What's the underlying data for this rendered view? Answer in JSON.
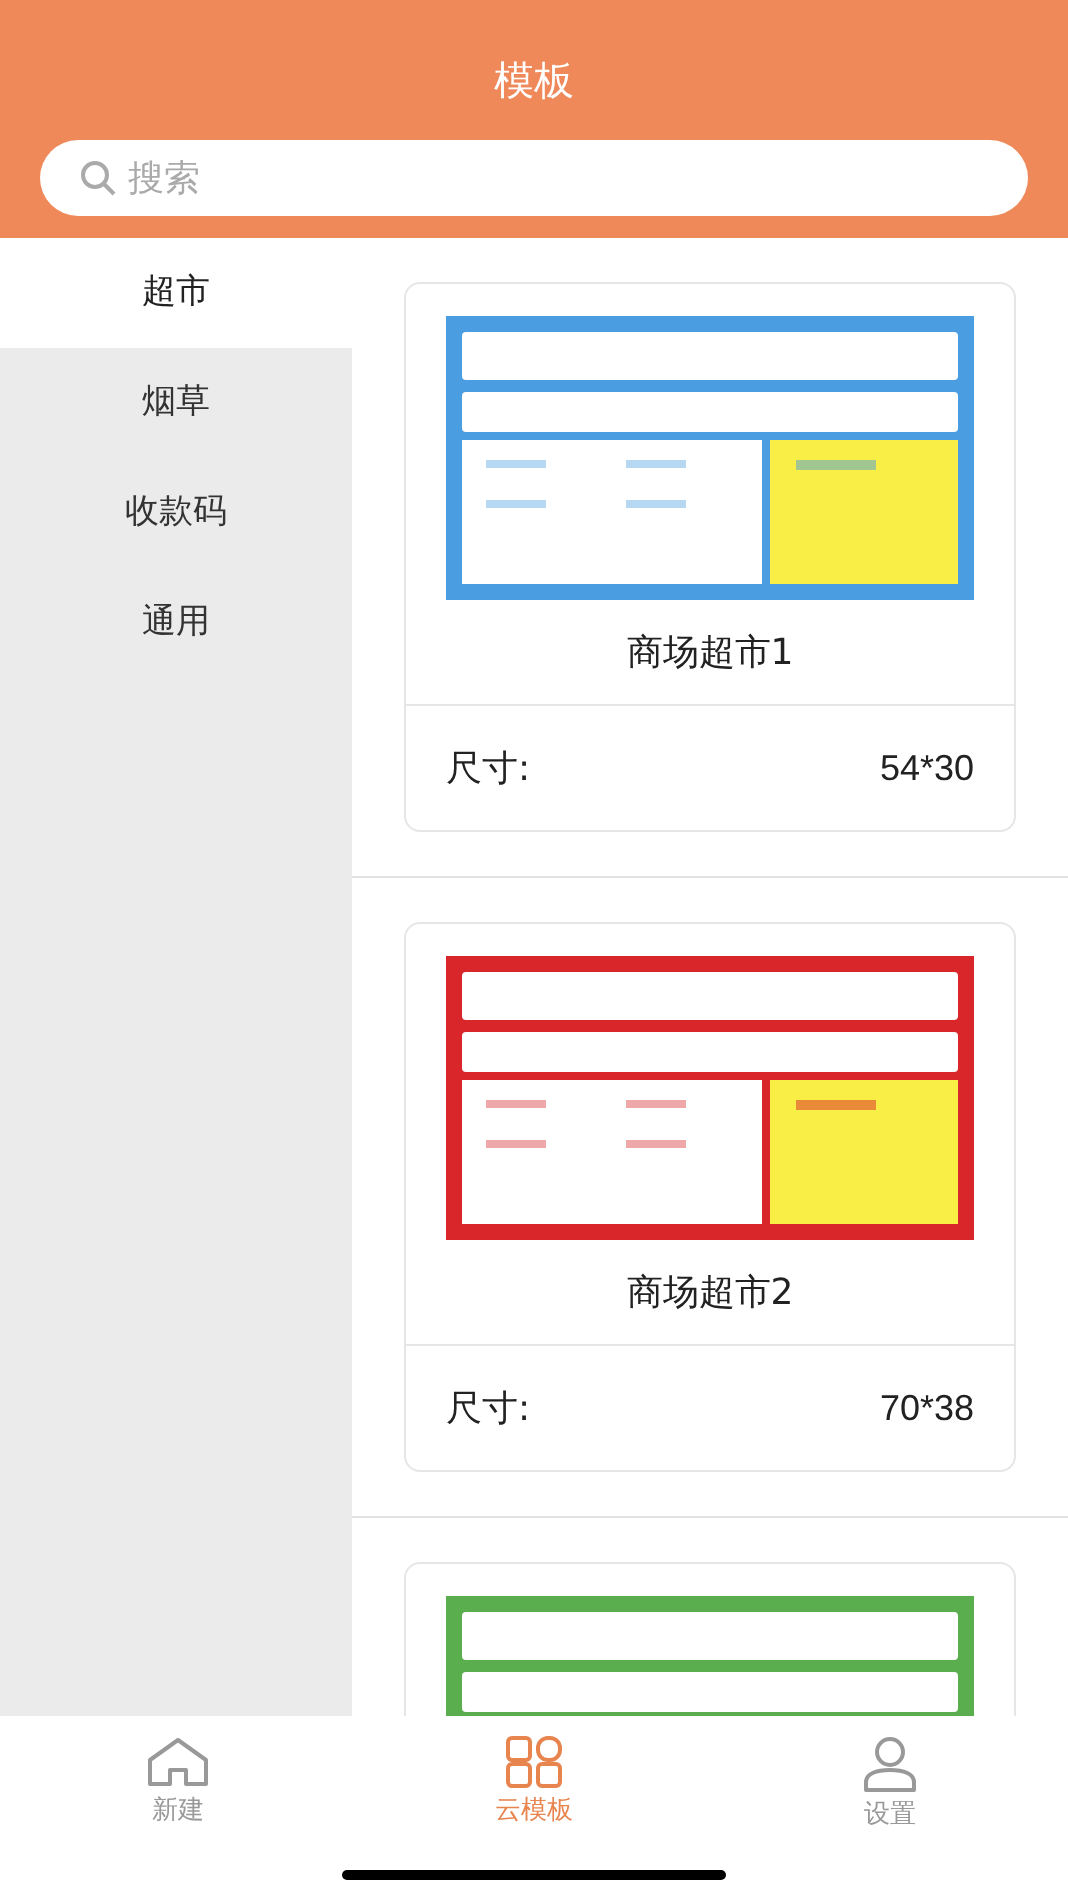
{
  "header": {
    "title": "模板"
  },
  "search": {
    "placeholder": "搜索"
  },
  "sidebar": {
    "items": [
      {
        "label": "超市",
        "selected": true
      },
      {
        "label": "烟草",
        "selected": false
      },
      {
        "label": "收款码",
        "selected": false
      },
      {
        "label": "通用",
        "selected": false
      }
    ]
  },
  "templates": [
    {
      "kind": "picture",
      "color": "#4a9de0",
      "name": "商场超市1",
      "size_label": "尺寸:",
      "size": "54*30"
    },
    {
      "kind": "picture",
      "color": "#d8262a",
      "name": "商场超市2",
      "size_label": "尺寸:",
      "size": "70*38"
    },
    {
      "kind": "picture",
      "color": "#5aae4e"
    }
  ],
  "tab_bar": [
    {
      "label": "新建",
      "kind": "home",
      "selected": false
    },
    {
      "label": "云模板",
      "kind": "grid",
      "selected": true
    },
    {
      "label": "设置",
      "kind": "user",
      "selected": false
    }
  ]
}
